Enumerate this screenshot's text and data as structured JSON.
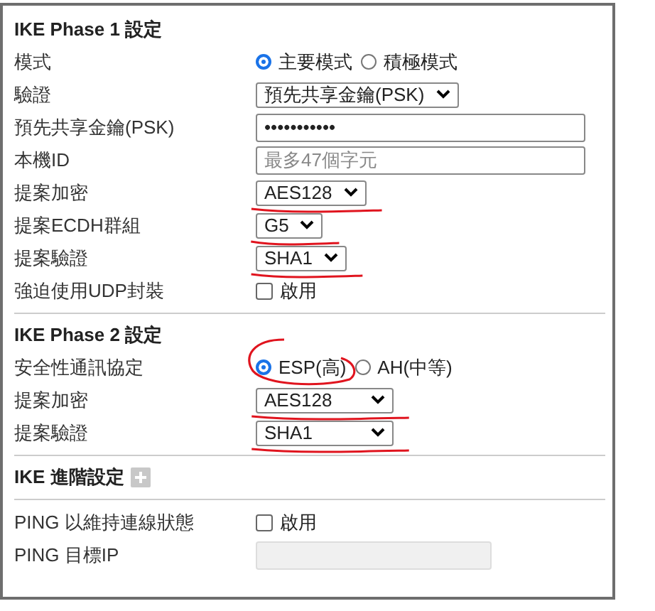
{
  "sections": [
    {
      "title": "IKE Phase 1 設定",
      "rows": [
        {
          "kind": "radio",
          "label": "模式",
          "options": [
            {
              "label": "主要模式",
              "selected": true,
              "circled": false
            },
            {
              "label": "積極模式",
              "selected": false,
              "circled": false
            }
          ]
        },
        {
          "kind": "select",
          "label": "驗證",
          "value": "預先共享金鑰(PSK)",
          "marked": false
        },
        {
          "kind": "password",
          "label": "預先共享金鑰(PSK)",
          "value": "•••••••••••"
        },
        {
          "kind": "text",
          "label": "本機ID",
          "placeholder": "最多47個字元",
          "disabled": false
        },
        {
          "kind": "select",
          "label": "提案加密",
          "value": "AES128",
          "marked": true
        },
        {
          "kind": "select",
          "label": "提案ECDH群組",
          "value": "G5",
          "marked": true
        },
        {
          "kind": "select",
          "label": "提案驗證",
          "value": "SHA1",
          "marked": true
        },
        {
          "kind": "checkbox",
          "label": "強迫使用UDP封裝",
          "option": "啟用",
          "checked": false
        }
      ]
    },
    {
      "title": "IKE Phase 2 設定",
      "rows": [
        {
          "kind": "radio",
          "label": "安全性通訊協定",
          "options": [
            {
              "label": "ESP(高)",
              "selected": true,
              "circled": true
            },
            {
              "label": "AH(中等)",
              "selected": false,
              "circled": false
            }
          ]
        },
        {
          "kind": "select",
          "label": "提案加密",
          "value": "AES128",
          "marked": true
        },
        {
          "kind": "select",
          "label": "提案驗證",
          "value": "SHA1",
          "marked": true
        }
      ]
    },
    {
      "title": "IKE 進階設定",
      "expanded": false
    },
    {
      "rows": [
        {
          "kind": "checkbox",
          "label": "PING 以維持連線狀態",
          "option": "啟用",
          "checked": false
        },
        {
          "kind": "text",
          "label": "PING 目標IP",
          "disabled": true
        }
      ]
    }
  ]
}
